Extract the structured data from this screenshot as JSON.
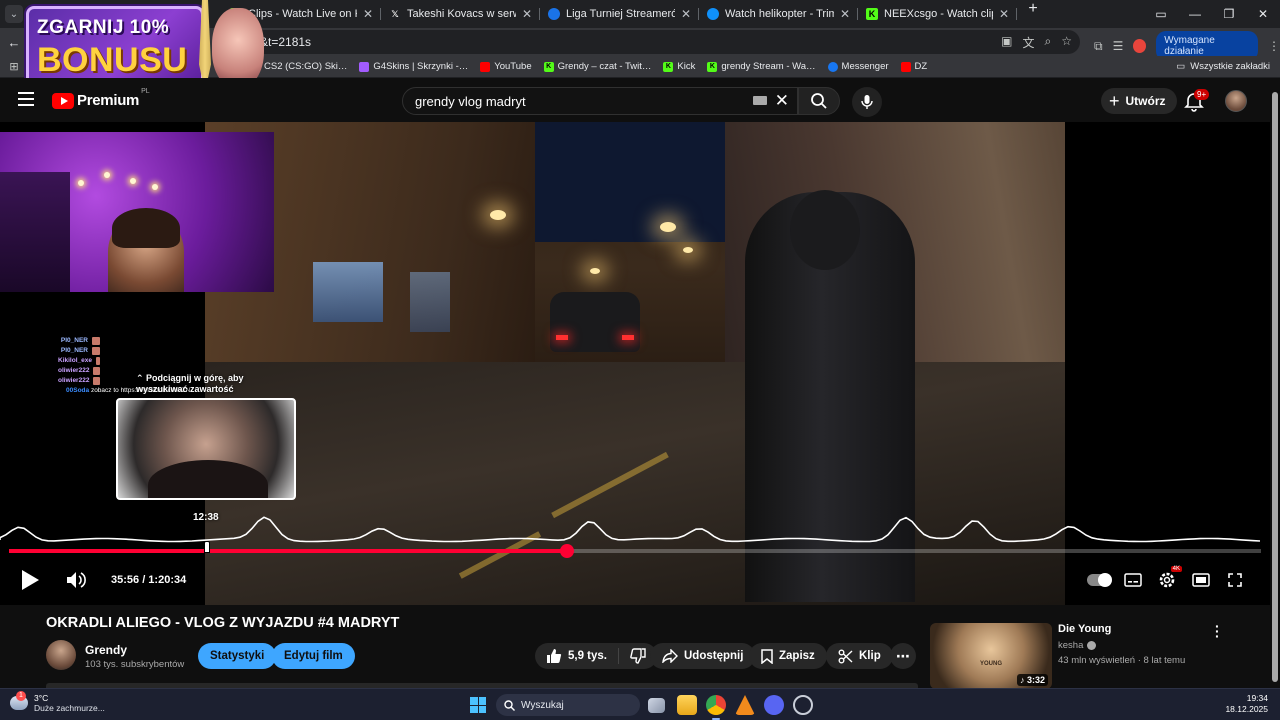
{
  "browser": {
    "tabs": [
      {
        "title": "Clips - Watch Live on Kick",
        "favicon": "kick",
        "color": "#53fc18"
      },
      {
        "title": "Takeshi Kovacs w serwisie X: „stra…",
        "favicon": "x",
        "color": "#000000"
      },
      {
        "title": "Liga Turniej Streamerów No Bull…",
        "favicon": "globe",
        "color": "#1a73e8"
      },
      {
        "title": "Watch helikopter - Trim | Stream…",
        "favicon": "streamable",
        "color": "#0f90fa"
      },
      {
        "title": "NEEXcsgo - Watch clips on Kick",
        "favicon": "kick",
        "color": "#53fc18"
      }
    ],
    "url_fragment": "&t=2181s",
    "required_action_label": "Wymagane działanie",
    "bookmarks": [
      {
        "label": "CS2 (CS:GO) Ski…",
        "color": "#f0a030"
      },
      {
        "label": "G4Skins | Skrzynki -…",
        "color": "#a35cff"
      },
      {
        "label": "YouTube",
        "color": "#ff0000"
      },
      {
        "label": "Grendy – czat - Twit…",
        "color": "#53fc18"
      },
      {
        "label": "Kick",
        "color": "#53fc18"
      },
      {
        "label": "grendy Stream - Wa…",
        "color": "#53fc18"
      },
      {
        "label": "Messenger",
        "color": "#1877f2"
      },
      {
        "label": "DZ",
        "color": "#ff0000"
      }
    ],
    "all_bookmarks_label": "Wszystkie zakładki"
  },
  "ad": {
    "line1": "ZGARNIJ 10%",
    "line2": "BONUSU"
  },
  "youtube": {
    "logo_text": "Premium",
    "country_code": "PL",
    "search_value": "grendy vlog madryt",
    "create_label": "Utwórz",
    "notifications_badge": "9+"
  },
  "player": {
    "current_time": "35:56",
    "duration": "1:20:34",
    "time_display": "35:56 / 1:20:34",
    "hover_time": "12:38",
    "progress_fraction": 0.4459,
    "hover_fraction": 0.1568,
    "settings_badge": "4K",
    "overlay": {
      "chat_names": [
        "PI0_NER",
        "PI0_NER",
        "Kikilol_exe",
        "oliwier222",
        "oliwier222"
      ],
      "chat_last_name": "00Soda",
      "chat_last_message": "zobacz to https://vm.tiktok.com/ZN…",
      "swipe_hint": "⌃ Podciągnij w górę, aby wyszukiwać zawartość"
    }
  },
  "video": {
    "title": "OKRADLI ALIEGO - VLOG Z WYJAZDU #4 MADRYT",
    "channel_name": "Grendy",
    "subscribers": "103 tys. subskrybentów",
    "stats_label": "Statystyki",
    "edit_label": "Edytuj film",
    "likes": "5,9 tys.",
    "share_label": "Udostępnij",
    "save_label": "Zapisz",
    "clip_label": "Klip"
  },
  "recommendation": {
    "title": "Die Young",
    "channel": "kesha",
    "meta": "43 mln wyświetleń · 8 lat temu",
    "duration": "3:32",
    "thumb_text": "YOUNG"
  },
  "taskbar": {
    "temperature": "3°C",
    "weather": "Duże zachmurze...",
    "weather_badge": "1",
    "search_placeholder": "Wyszukaj",
    "time": "19:34",
    "date": "18.12.2025"
  }
}
